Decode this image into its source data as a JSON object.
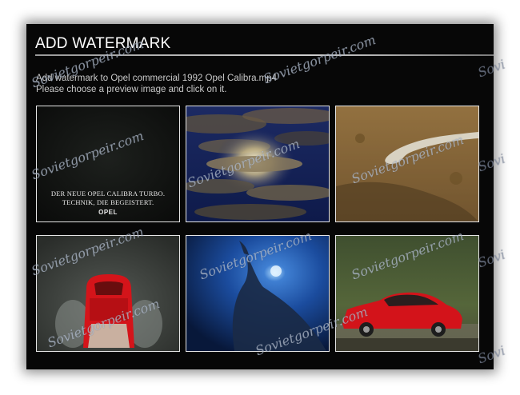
{
  "dialog": {
    "title": "ADD WATERMARK",
    "line1": "Add watermark to Opel commercial 1992 Opel Calibra.mp4",
    "line2": "Please choose a preview image and click on it."
  },
  "thumbnails": [
    {
      "scene": "title-card",
      "caption_line1": "DER NEUE OPEL CALIBRA TURBO.",
      "caption_line2": "TECHNIK, DIE BEGEISTERT.",
      "logo": "OPEL"
    },
    {
      "scene": "moonlit-clouds"
    },
    {
      "scene": "mountain-road"
    },
    {
      "scene": "red-car-top-view"
    },
    {
      "scene": "underwater-whale"
    },
    {
      "scene": "red-coupe-side"
    }
  ],
  "watermark_text": "Sovietgorpeir.com"
}
